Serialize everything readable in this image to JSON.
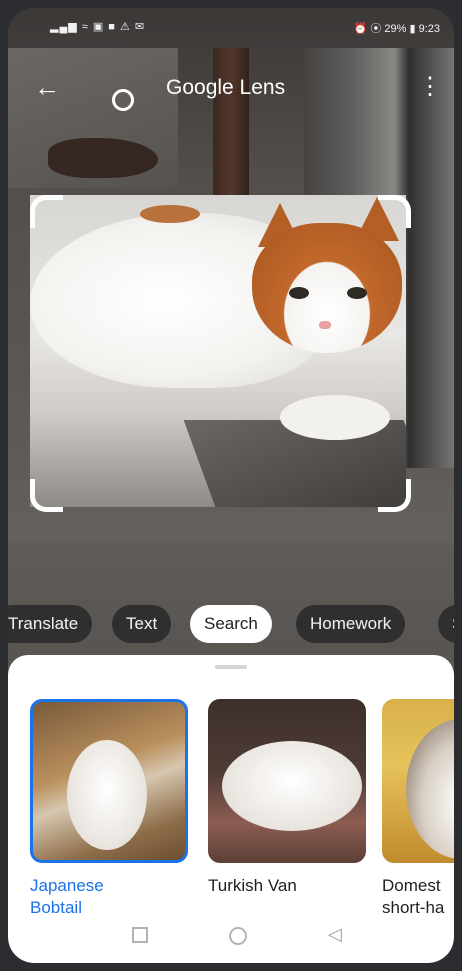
{
  "status_bar": {
    "left": "▂▄▆ ≈ ▣ ■ ⚠ ✉",
    "right": "⏰ ⦿ 29% ▮ 9:23"
  },
  "app_bar": {
    "title": "Google Lens",
    "back_icon": "arrow-left-icon",
    "menu_icon": "more-vertical-icon",
    "shutter_icon": "shutter-circle-icon"
  },
  "modes": {
    "items": [
      {
        "label": "Translate"
      },
      {
        "label": "Text"
      },
      {
        "label": "Search",
        "active": true
      },
      {
        "label": "Homework"
      },
      {
        "label": "S"
      }
    ]
  },
  "results": {
    "items": [
      {
        "label": "Japanese\nBobtail",
        "selected": true
      },
      {
        "label": "Turkish Van",
        "selected": false
      },
      {
        "label": "Domest\nshort-ha",
        "selected": false
      }
    ]
  },
  "colors": {
    "accent": "#1a73e8",
    "chip_bg": "#2f2f2f",
    "sheet_bg": "#ffffff"
  },
  "nav_bar": {
    "icons": [
      "square-icon",
      "circle-icon",
      "triangle-back-icon"
    ]
  }
}
